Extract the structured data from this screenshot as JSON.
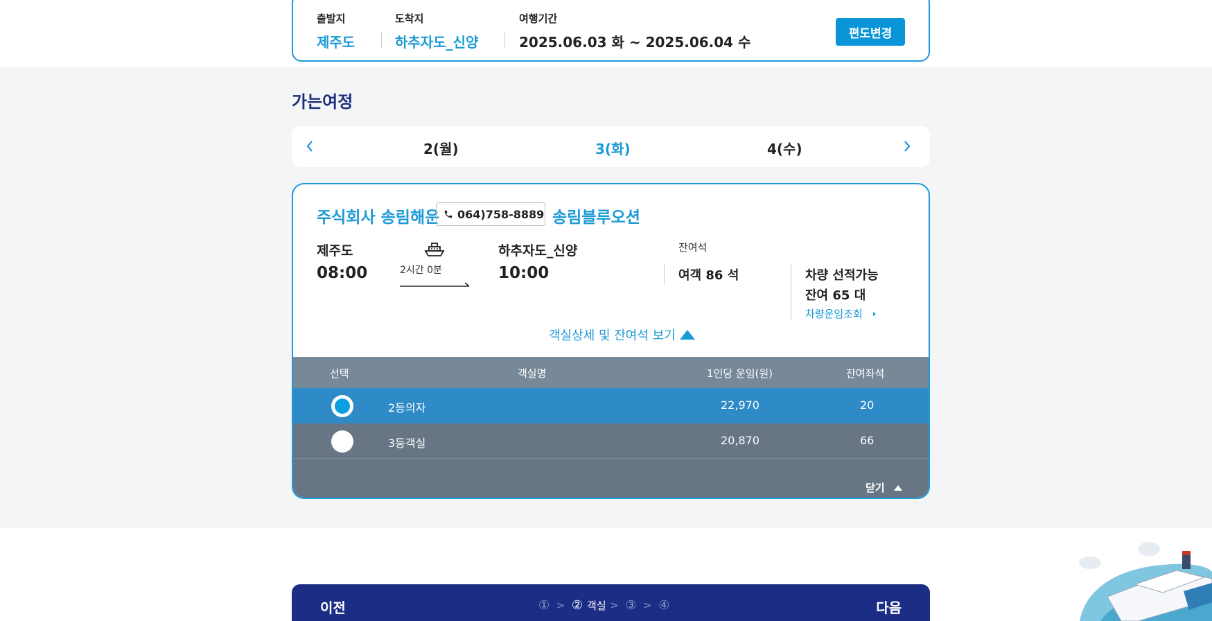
{
  "search": {
    "origin_label": "출발지",
    "origin_value": "제주도",
    "dest_label": "도착지",
    "dest_value": "하추자도_신양",
    "period_label": "여행기간",
    "period_value": "2025.06.03 화 ~ 2025.06.04 수",
    "change_button": "편도변경"
  },
  "section_title": "가는여정",
  "dates": [
    {
      "label": "2(월)",
      "active": false
    },
    {
      "label": "3(화)",
      "active": true
    },
    {
      "label": "4(수)",
      "active": false
    }
  ],
  "voyage": {
    "company": "주식회사 송림해운",
    "phone": "064)758-8889",
    "ship": "송림블루오션",
    "depart_port": "제주도",
    "depart_time": "08:00",
    "duration": "2시간 0분",
    "arrive_port": "하추자도_신양",
    "arrive_time": "10:00",
    "remain_label": "잔여석",
    "passenger": "여객 86 석",
    "vehicle_line1": "차량 선적가능",
    "vehicle_line2": "잔여 65 대",
    "vehicle_link": "차량운임조회",
    "detail_toggle": "객실상세 및 잔여석 보기"
  },
  "table": {
    "headers": [
      "선택",
      "객실명",
      "1인당 운임(원)",
      "잔여좌석"
    ],
    "rows": [
      {
        "name": "2등의자",
        "fare": "22,970",
        "seats": "20",
        "selected": true
      },
      {
        "name": "3등객실",
        "fare": "20,870",
        "seats": "66",
        "selected": false
      }
    ],
    "close": "닫기"
  },
  "bottom": {
    "prev": "이전",
    "next": "다음",
    "steps": [
      "①",
      "②",
      "③",
      "④"
    ],
    "active_step_name": "객실"
  },
  "colors": {
    "accent": "#1a9ad6",
    "navy": "#1c2d85",
    "selected_row": "#2f8bc7",
    "table_bg": "#677585"
  }
}
